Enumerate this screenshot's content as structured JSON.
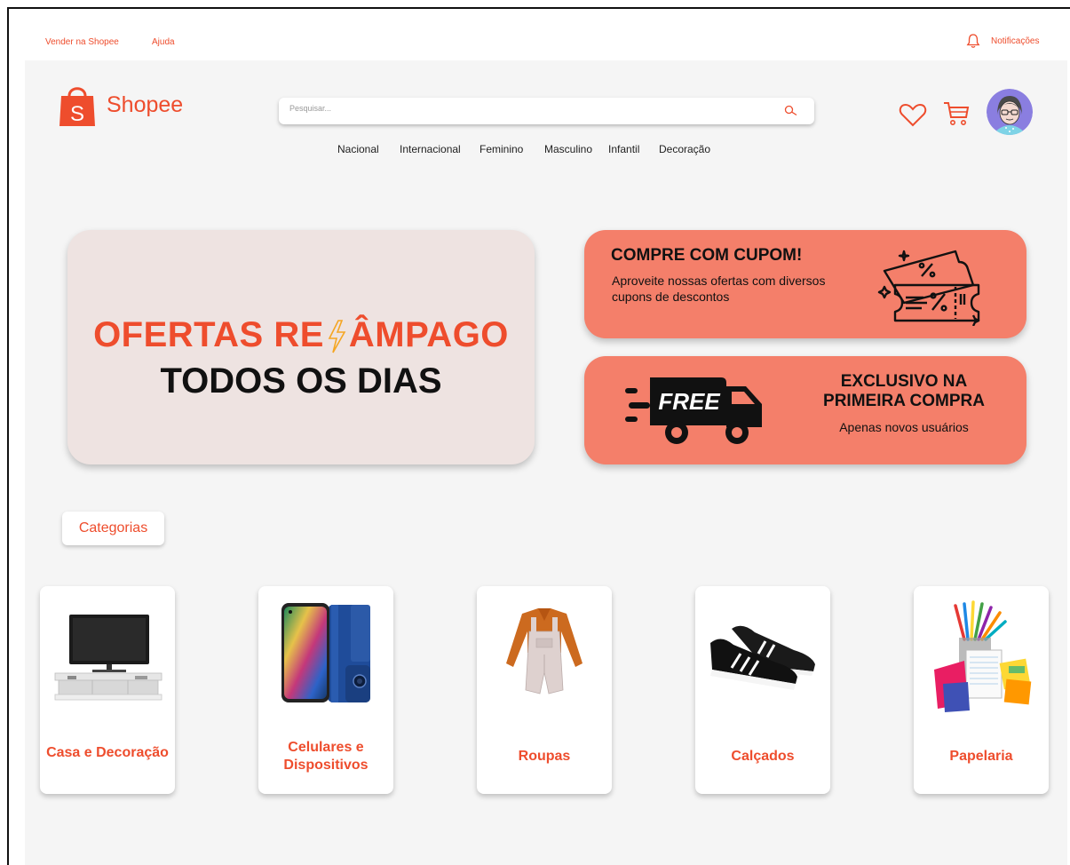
{
  "topbar": {
    "sell_link": "Vender na Shopee",
    "help_link": "Ajuda",
    "notifications_label": "Notificações"
  },
  "header": {
    "logo_letter": "S",
    "logo_text": "Shopee",
    "search_placeholder": "Pesquisar...",
    "nav_items": [
      "Nacional",
      "Internacional",
      "Feminino",
      "Masculino",
      "Infantil",
      "Decoração"
    ]
  },
  "hero": {
    "line1_before": "OFERTAS RE",
    "line1_after": "ÂMPAGO",
    "line2": "TODOS OS DIAS"
  },
  "promo_coupon": {
    "title": "COMPRE COM CUPOM!",
    "subtitle": "Aproveite nossas ofertas com diversos cupons de descontos"
  },
  "promo_shipping": {
    "truck_text": "FREE",
    "title": "EXCLUSIVO NA PRIMEIRA COMPRA",
    "subtitle": "Apenas novos usuários"
  },
  "categories": {
    "label": "Categorias",
    "items": [
      {
        "name": "Casa e Decoração"
      },
      {
        "name": "Celulares e Dispositivos"
      },
      {
        "name": "Roupas"
      },
      {
        "name": "Calçados"
      },
      {
        "name": "Papelaria"
      }
    ]
  },
  "colors": {
    "brand": "#ee4d2d",
    "promo_bg": "#f47f6a",
    "hero_bg": "#eee3e1",
    "page_bg": "#f5f5f5"
  }
}
